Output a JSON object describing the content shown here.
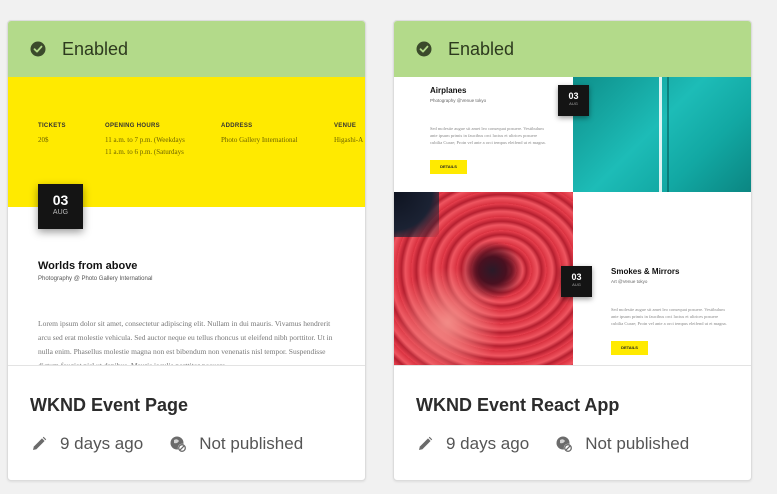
{
  "cards": [
    {
      "status": "Enabled",
      "title": "WKND Event Page",
      "modified": "9 days ago",
      "publish_status": "Not published",
      "thumbnail": {
        "columns": [
          {
            "heading": "TICKETS",
            "value": "20$"
          },
          {
            "heading": "OPENING HOURS",
            "value": "11 a.m. to 7 p.m. (Weekdays\n11 a.m. to 6 p.m. (Saturdays"
          },
          {
            "heading": "ADDRESS",
            "value": "Photo Gallery International"
          },
          {
            "heading": "VENUE",
            "value": "Higashi-A"
          }
        ],
        "date_day": "03",
        "date_month": "AUG",
        "event_title": "Worlds from above",
        "event_subtitle": "Photography @ Photo Gallery International",
        "body": "Lorem ipsum dolor sit amet, consectetur adipiscing elit. Nullam in dui mauris. Vivamus hendrerit arcu sed erat molestie vehicula. Sed auctor neque eu tellus rhoncus ut eleifend nibh porttitor. Ut in nulla enim. Phasellus molestie magna non est bibendum non venenatis nisl tempor. Suspendisse dictum feugiat nisl ut dapibus. Mauris iaculis porttitor posuere."
      }
    },
    {
      "status": "Enabled",
      "title": "WKND Event React App",
      "modified": "9 days ago",
      "publish_status": "Not published",
      "thumbnail": {
        "event1_title": "Airplanes",
        "event1_subtitle": "Photography @Venue tokyo",
        "event1_body": "Sed molestie augue sit amet leo consequat posuere. Vestibulum ante ipsum primis in faucibus orci luctus et ultrices posuere cubilia Curae; Proin vel ante a orci tempus eleifend ut et magna.",
        "event1_button": "DETAILS",
        "event1_day": "03",
        "event1_month": "AUG",
        "event2_title": "Smokes & Mirrors",
        "event2_subtitle": "Art @Venue tokyo",
        "event2_body": "Sed molestie augue sit amet leo consequat posuere. Vestibulum ante ipsum primis in faucibus orci luctus et ultrices posuere cubilia Curae; Proin vel ante a orci tempus eleifend ut et magna.",
        "event2_button": "DETAILS",
        "event2_day": "03",
        "event2_month": "AUG"
      }
    }
  ],
  "icons": {
    "status": "checkmark-circle-icon",
    "modified": "pencil-icon",
    "publish": "globe-unpublished-icon"
  },
  "colors": {
    "enabled_bar": "#b3da8a",
    "thumb_yellow": "#ffea00"
  }
}
